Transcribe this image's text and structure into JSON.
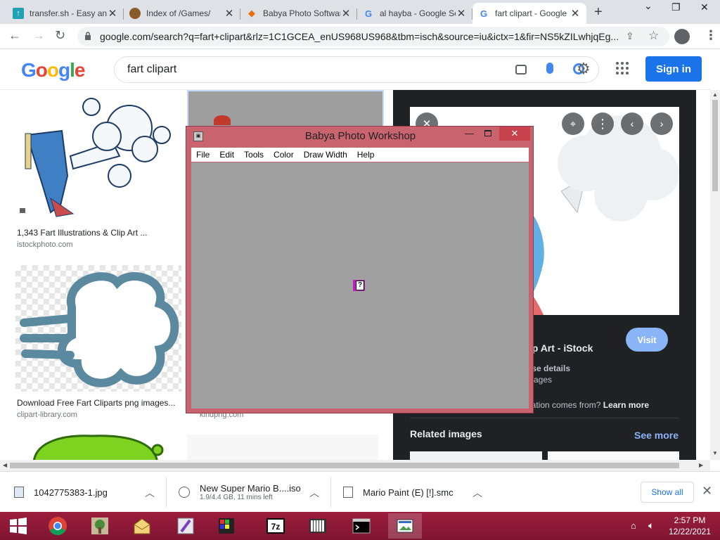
{
  "tabs": [
    {
      "title": "transfer.sh - Easy and fast file sharing",
      "favicon": "upload-icon",
      "active": false
    },
    {
      "title": "Index of /Games/",
      "favicon": "game-icon",
      "active": false
    },
    {
      "title": "Babya Photo Software",
      "favicon": "diamond-icon",
      "active": false
    },
    {
      "title": "al hayba - Google Search",
      "favicon": "google-icon",
      "active": false
    },
    {
      "title": "fart clipart - Google Search",
      "favicon": "google-icon",
      "active": true
    }
  ],
  "toolbar": {
    "url": "google.com/search?q=fart+clipart&rlz=1C1GCEA_enUS968US968&tbm=isch&source=iu&ictx=1&fir=NS5kZILwhjqEg..."
  },
  "google": {
    "logo": "Google",
    "query": "fart clipart",
    "signin": "Sign in"
  },
  "results": [
    {
      "caption": "1,343 Fart Illustrations & Clip Art ...",
      "source": "istockphoto.com"
    },
    {
      "caption": "Download Free Fart Cliparts png images...",
      "source": "clipart-library.com"
    },
    {
      "caption": "",
      "source": "kindpng.com"
    }
  ],
  "preview": {
    "title_partial": "lip Art - iStock",
    "license_partial": "nse details",
    "images_partial": "mages",
    "info_partial": "nation comes from?",
    "learn_more": "Learn more",
    "visit": "Visit",
    "related": "Related images",
    "see_more": "See more"
  },
  "downloads": [
    {
      "name": "1042775383-1.jpg",
      "status": ""
    },
    {
      "name": "New Super Mario B....iso",
      "status": "1.9/4.4 GB, 11 mins left"
    },
    {
      "name": "Mario Paint (E) [!].smc",
      "status": ""
    }
  ],
  "download_bar": {
    "show_all": "Show all"
  },
  "taskbar": {
    "apps": [
      "start-icon",
      "chrome-icon",
      "garden-icon",
      "mail-icon",
      "paintbrush-icon",
      "paint-icon",
      "7zip-icon",
      "piano-icon",
      "terminal-icon",
      "photo-workshop-icon"
    ],
    "time": "2:57 PM",
    "date": "12/22/2021"
  },
  "app_window": {
    "title": "Babya Photo Workshop",
    "menu": [
      "File",
      "Edit",
      "Tools",
      "Color",
      "Draw Width",
      "Help"
    ],
    "placeholder_glyph": "?"
  },
  "colors": {
    "window_frame": "#c9646f",
    "taskbar": "#9c1d3e",
    "google_blue": "#1a73e8",
    "canvas": "#a0a0a0"
  }
}
